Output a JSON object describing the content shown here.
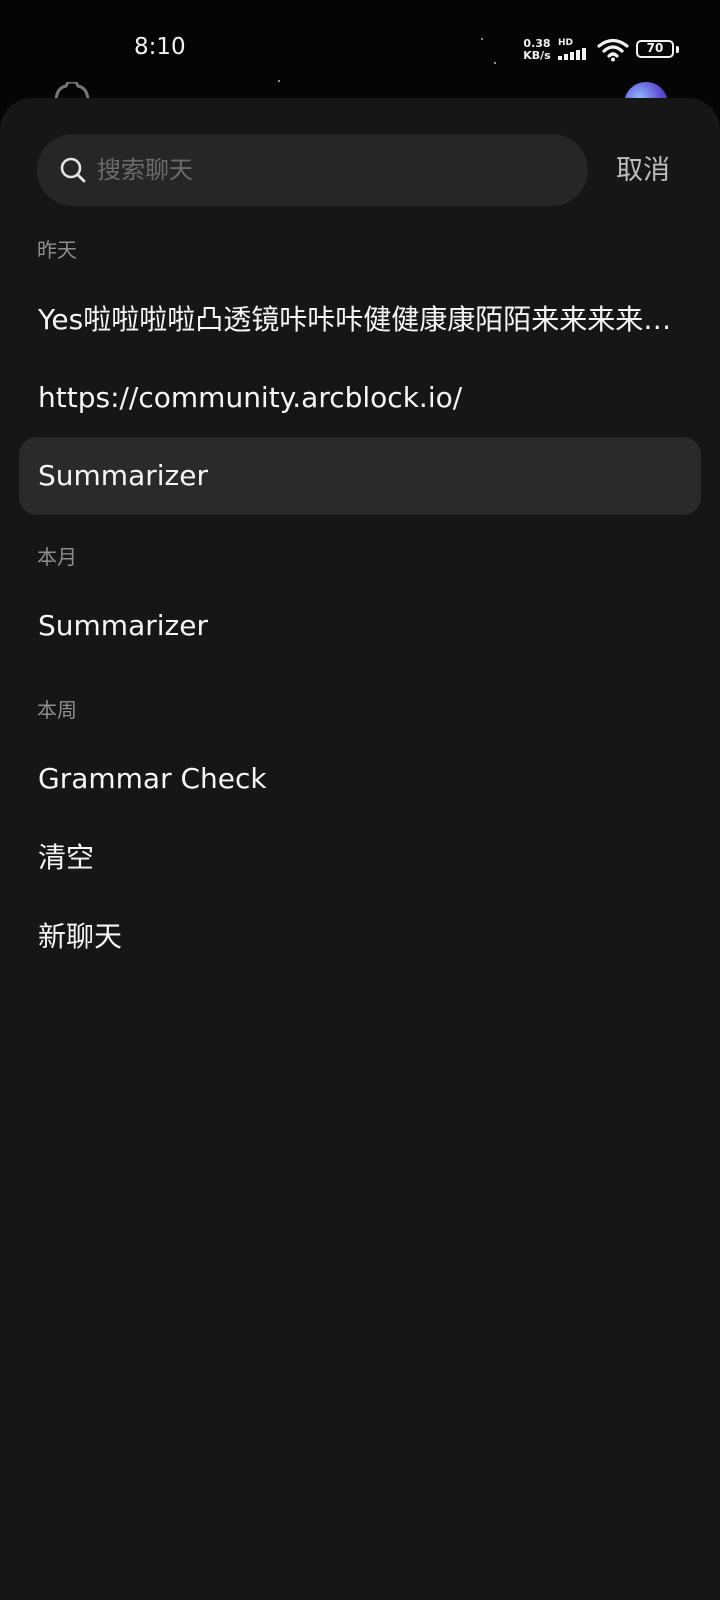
{
  "status_bar": {
    "time": "8:10",
    "net_speed_value": "0.38",
    "net_speed_unit": "KB/s",
    "network_badge": "HD",
    "battery_level": "70",
    "icons": [
      "signal-icon",
      "wifi-icon",
      "battery-icon"
    ]
  },
  "search": {
    "placeholder": "搜索聊天",
    "cancel_label": "取消"
  },
  "sections": [
    {
      "title": "昨天",
      "items": [
        {
          "label": "Yes啦啦啦啦凸透镜咔咔咔健健康康陌陌来来来来来来来"
        },
        {
          "label": "https://community.arcblock.io/"
        },
        {
          "label": "Summarizer",
          "selected": true
        }
      ]
    },
    {
      "title": "本月",
      "items": [
        {
          "label": "Summarizer"
        }
      ]
    },
    {
      "title": "本周",
      "items": [
        {
          "label": "Grammar Check"
        },
        {
          "label": "清空"
        },
        {
          "label": "新聊天"
        }
      ]
    }
  ],
  "colors": {
    "background": "#050505",
    "sheet": "#161616",
    "search_box": "#262626",
    "selected_item": "#2a2a2a",
    "primary_text": "#f5f5f5",
    "secondary_text": "#8e8e8e",
    "placeholder_text": "#6b6b6b"
  }
}
